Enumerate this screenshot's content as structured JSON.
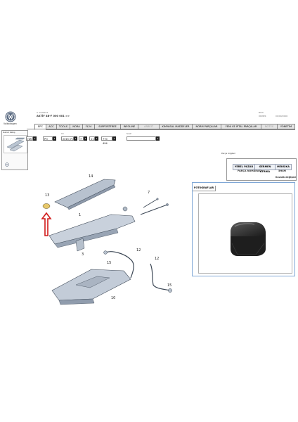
{
  "brand": {
    "name": "Volkswagen"
  },
  "header": {
    "line1": "A 3449915",
    "line2": "AKTİF 4B-F 000 001 >>",
    "right_line1": "BTW",
    "right_status_a": "ÖRNEK",
    "right_status_b": "00/00/0000"
  },
  "tabs": [
    {
      "label": "EPC",
      "state": "active"
    },
    {
      "label": "ACC",
      "state": "normal"
    },
    {
      "label": "TOOLS",
      "state": "normal"
    },
    {
      "label": "NORA",
      "state": "normal"
    },
    {
      "label": "FL24",
      "state": "normal"
    },
    {
      "label": "SUPPORTFREE",
      "state": "normal"
    },
    {
      "label": "INFOLINE",
      "state": "normal"
    },
    {
      "label": "ARBEIT",
      "state": "disabled"
    },
    {
      "label": "KIMYASAL MADDELER",
      "state": "normal"
    },
    {
      "label": "NORM PARÇALAR",
      "state": "normal"
    },
    {
      "label": "YENİ VE İPTAL PARÇALAR",
      "state": "normal"
    },
    {
      "label": "NOTES",
      "state": "disabled"
    },
    {
      "label": "YÖNETİM",
      "state": "normal"
    }
  ],
  "filters": {
    "f1": {
      "label": "",
      "value": "HW"
    },
    "f2": {
      "label": "",
      "value": "PO"
    },
    "f3": {
      "label": "Yıl",
      "value": "2015 (F)"
    },
    "f4": {
      "label": "",
      "value": "7"
    },
    "f5": {
      "label": "",
      "value": "11"
    },
    "f6": {
      "label": "",
      "value": "770 494"
    },
    "f7": {
      "label": "Sınıf",
      "value": ""
    }
  },
  "thumbnail_panel": {
    "title": "Genel bakış"
  },
  "diagram": {
    "callouts": [
      "14",
      "13",
      "1",
      "3",
      "7",
      "12",
      "15",
      "12",
      "15",
      "10"
    ]
  },
  "parts_panel": {
    "title": "Parça bilgileri",
    "tabs": [
      "YEREL PAZAR",
      "GERMEN ATRIKA",
      "MEKSIKA"
    ],
    "part_number_label": "PARÇA NUMARASI",
    "part_number_value": "5H4M",
    "part_name_fragment": "Kavalık değişme"
  },
  "photo_window": {
    "title": "FOTOĞRAFLAR"
  }
}
